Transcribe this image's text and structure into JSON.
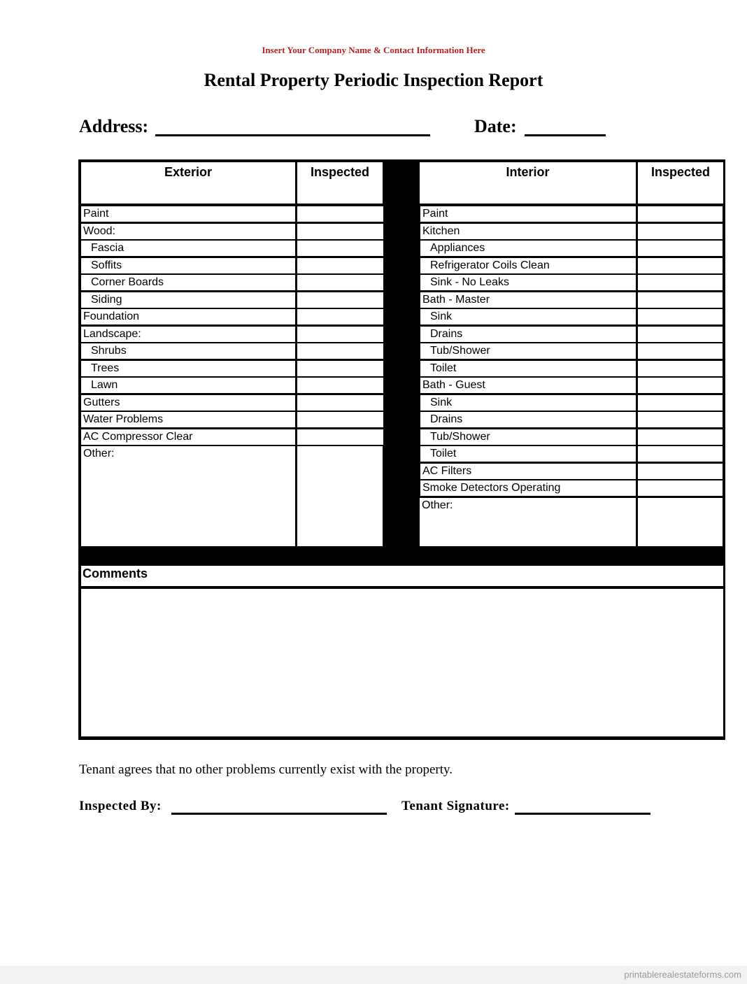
{
  "header": {
    "company_placeholder": "Insert Your Company Name & Contact Information Here",
    "title": "Rental Property Periodic Inspection Report"
  },
  "fields": {
    "address_label": "Address:",
    "address_value": "",
    "date_label": "Date:",
    "date_value": ""
  },
  "exterior": {
    "heading": "Exterior",
    "inspected_heading": "Inspected",
    "items": [
      {
        "label": "Paint",
        "indent": false
      },
      {
        "label": "Wood:",
        "indent": false
      },
      {
        "label": "Fascia",
        "indent": true
      },
      {
        "label": "Soffits",
        "indent": true
      },
      {
        "label": "Corner Boards",
        "indent": true
      },
      {
        "label": "Siding",
        "indent": true
      },
      {
        "label": "Foundation",
        "indent": false
      },
      {
        "label": "Landscape:",
        "indent": false
      },
      {
        "label": "Shrubs",
        "indent": true
      },
      {
        "label": "Trees",
        "indent": true
      },
      {
        "label": "Lawn",
        "indent": true
      },
      {
        "label": "Gutters",
        "indent": false
      },
      {
        "label": "Water Problems",
        "indent": false
      },
      {
        "label": "AC Compressor Clear",
        "indent": false
      }
    ],
    "other_label": "Other:"
  },
  "interior": {
    "heading": "Interior",
    "inspected_heading": "Inspected",
    "items": [
      {
        "label": "Paint",
        "indent": false
      },
      {
        "label": "Kitchen",
        "indent": false
      },
      {
        "label": "Appliances",
        "indent": true
      },
      {
        "label": "Refrigerator Coils Clean",
        "indent": true
      },
      {
        "label": "Sink - No Leaks",
        "indent": true
      },
      {
        "label": "Bath - Master",
        "indent": false
      },
      {
        "label": "Sink",
        "indent": true
      },
      {
        "label": "Drains",
        "indent": true
      },
      {
        "label": "Tub/Shower",
        "indent": true
      },
      {
        "label": "Toilet",
        "indent": true
      },
      {
        "label": "Bath - Guest",
        "indent": false
      },
      {
        "label": "Sink",
        "indent": true
      },
      {
        "label": "Drains",
        "indent": true
      },
      {
        "label": "Tub/Shower",
        "indent": true
      },
      {
        "label": "Toilet",
        "indent": true
      },
      {
        "label": "AC Filters",
        "indent": false
      },
      {
        "label": "Smoke Detectors Operating",
        "indent": false
      }
    ],
    "other_label": "Other:"
  },
  "comments": {
    "label": "Comments",
    "value": ""
  },
  "agreement": "Tenant agrees that no other problems currently exist with the property.",
  "signatures": {
    "inspected_by_label": "Inspected By:",
    "inspected_by_value": "",
    "tenant_signature_label": "Tenant Signature:",
    "tenant_signature_value": ""
  },
  "footer": {
    "watermark": "printablerealestateforms.com"
  },
  "colors": {
    "company_text": "#b22222",
    "border": "#000000",
    "footer_bg": "#f2f2f2"
  }
}
